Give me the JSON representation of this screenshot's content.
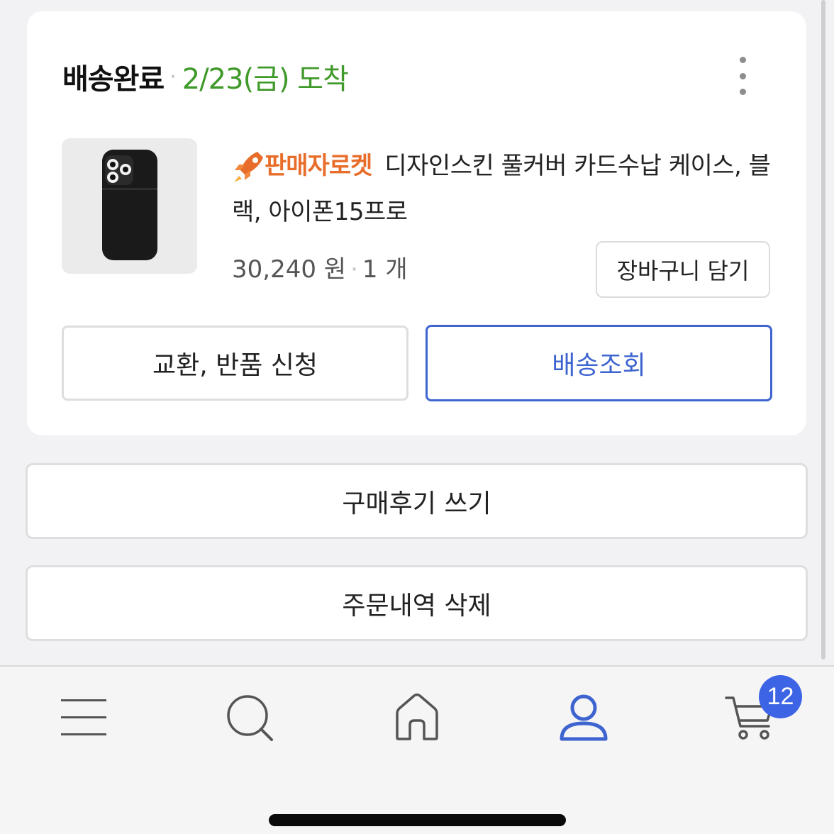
{
  "order": {
    "status": "배송완료",
    "separator": "·",
    "arrival": "2/23(금) 도착",
    "badge_label": "판매자로켓",
    "product_name": "디자인스킨 풀커버 카드수납 케이스, 블랙, 아이폰15프로",
    "price": "30,240 원",
    "quantity": "1 개",
    "add_to_cart_label": "장바구니 담기",
    "exchange_return_label": "교환, 반품 신청",
    "tracking_label": "배송조회"
  },
  "actions": {
    "review_label": "구매후기 쓰기",
    "delete_label": "주문내역 삭제"
  },
  "tab_bar": {
    "items": [
      {
        "icon": "menu-icon"
      },
      {
        "icon": "search-icon"
      },
      {
        "icon": "home-icon"
      },
      {
        "icon": "user-icon",
        "active": true
      },
      {
        "icon": "cart-icon"
      }
    ],
    "cart_count": "12"
  },
  "colors": {
    "arrival_green": "#3f9a2a",
    "badge_orange": "#e86d2a",
    "accent_blue": "#3e64cf",
    "cart_badge_blue": "#3e64e6"
  }
}
